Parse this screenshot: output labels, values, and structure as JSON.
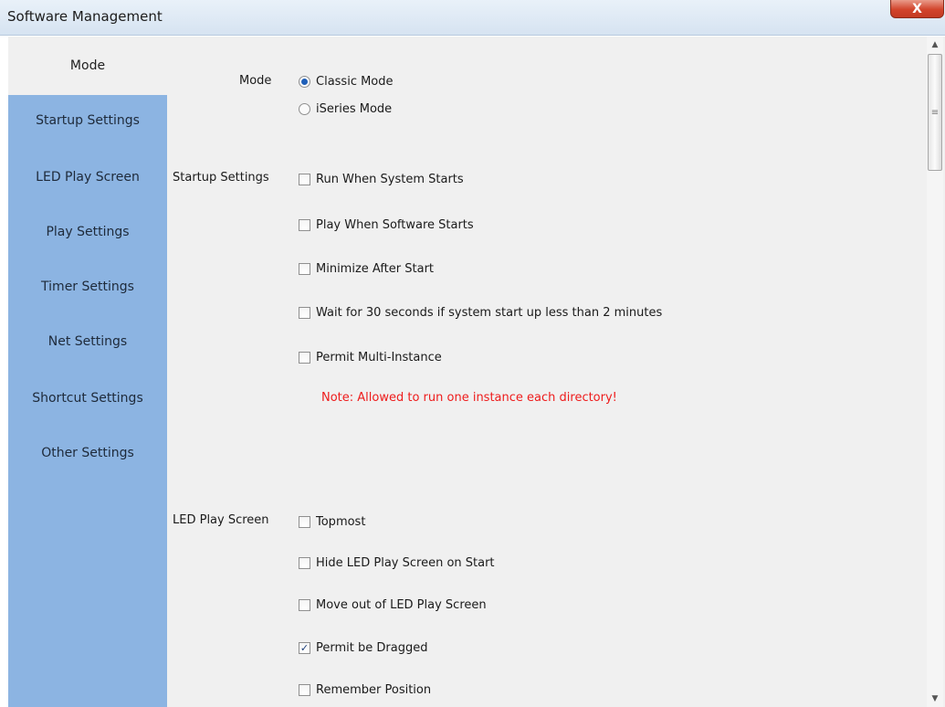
{
  "window": {
    "title": "Software Management",
    "close_label": "X"
  },
  "nav": {
    "active": "Mode",
    "items": [
      "Startup Settings",
      "LED Play Screen",
      "Play Settings",
      "Timer Settings",
      "Net Settings",
      "Shortcut Settings",
      "Other Settings"
    ]
  },
  "mode": {
    "label": "Mode",
    "options": [
      {
        "label": "Classic Mode",
        "selected": true
      },
      {
        "label": "iSeries Mode",
        "selected": false
      }
    ]
  },
  "startup": {
    "label": "Startup Settings",
    "options": [
      {
        "label": "Run When System Starts",
        "checked": false
      },
      {
        "label": "Play When Software Starts",
        "checked": false
      },
      {
        "label": "Minimize After Start",
        "checked": false
      },
      {
        "label": "Wait for 30 seconds if system start up less than 2 minutes",
        "checked": false
      },
      {
        "label": "Permit Multi-Instance",
        "checked": false
      }
    ],
    "note": "Note: Allowed to run one instance each directory!"
  },
  "led": {
    "label": "LED Play Screen",
    "options": [
      {
        "label": "Topmost",
        "checked": false
      },
      {
        "label": "Hide LED Play Screen on Start",
        "checked": false
      },
      {
        "label": "Move out of LED Play Screen",
        "checked": false
      },
      {
        "label": "Permit be Dragged",
        "checked": true
      },
      {
        "label": "Remember Position",
        "checked": false
      }
    ]
  },
  "colors": {
    "nav_panel": "#8cb4e2",
    "note": "#ee1c1c",
    "close": "#d2442b"
  },
  "icons": {
    "close": "close-icon",
    "scroll_up": "arrow-up-icon",
    "scroll_down": "arrow-down-icon",
    "grip": "grip-icon"
  }
}
